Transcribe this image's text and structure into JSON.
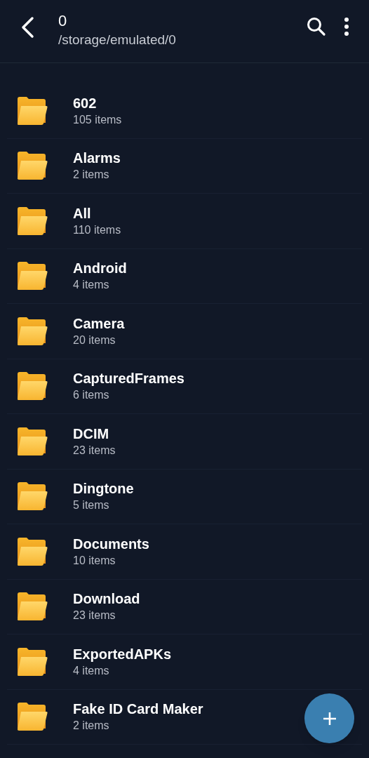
{
  "header": {
    "title": "0",
    "path": "/storage/emulated/0"
  },
  "folders": [
    {
      "name": "602",
      "count": "105 items"
    },
    {
      "name": "Alarms",
      "count": "2 items"
    },
    {
      "name": "All",
      "count": "110 items"
    },
    {
      "name": "Android",
      "count": "4 items"
    },
    {
      "name": "Camera",
      "count": "20 items"
    },
    {
      "name": "CapturedFrames",
      "count": "6 items"
    },
    {
      "name": "DCIM",
      "count": "23 items"
    },
    {
      "name": "Dingtone",
      "count": "5 items"
    },
    {
      "name": "Documents",
      "count": "10 items"
    },
    {
      "name": "Download",
      "count": "23 items"
    },
    {
      "name": "ExportedAPKs",
      "count": "4 items"
    },
    {
      "name": "Fake ID Card Maker",
      "count": "2 items"
    }
  ]
}
